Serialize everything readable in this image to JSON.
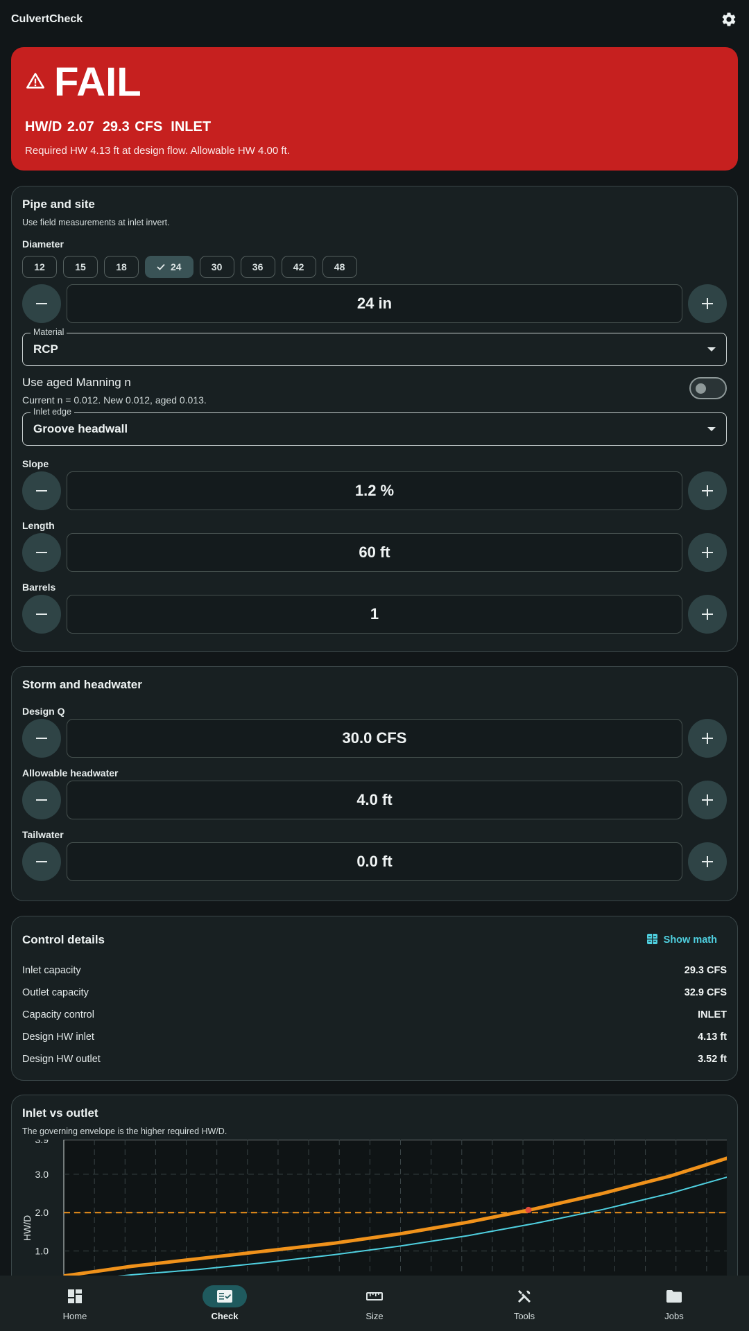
{
  "app": {
    "title": "CulvertCheck"
  },
  "result": {
    "status": "FAIL",
    "hw_d": "HW/D 2.07",
    "flow": "29.3 CFS",
    "control": "INLET",
    "note": "Required HW 4.13 ft at design flow. Allowable HW 4.00 ft.",
    "color": "#c6201f"
  },
  "pipe": {
    "title": "Pipe and site",
    "subtitle": "Use field measurements at inlet invert.",
    "diameter_label": "Diameter",
    "diameter_options": [
      "12",
      "15",
      "18",
      "24",
      "30",
      "36",
      "42",
      "48"
    ],
    "diameter_selected": "24",
    "diameter_value": "24 in",
    "material_label": "Material",
    "material_value": "RCP",
    "aged_title": "Use aged Manning n",
    "aged_sub": "Current n = 0.012. New 0.012, aged 0.013.",
    "aged_enabled": false,
    "inlet_label": "Inlet edge",
    "inlet_value": "Groove headwall",
    "slope_label": "Slope",
    "slope_value": "1.2 %",
    "length_label": "Length",
    "length_value": "60 ft",
    "barrels_label": "Barrels",
    "barrels_value": "1"
  },
  "storm": {
    "title": "Storm and headwater",
    "q_label": "Design Q",
    "q_value": "30.0 CFS",
    "hw_label": "Allowable headwater",
    "hw_value": "4.0 ft",
    "tw_label": "Tailwater",
    "tw_value": "0.0 ft"
  },
  "control": {
    "title": "Control details",
    "show_math": "Show math",
    "rows": [
      {
        "k": "Inlet capacity",
        "v": "29.3 CFS"
      },
      {
        "k": "Outlet capacity",
        "v": "32.9 CFS"
      },
      {
        "k": "Capacity control",
        "v": "INLET"
      },
      {
        "k": "Design HW inlet",
        "v": "4.13 ft"
      },
      {
        "k": "Design HW outlet",
        "v": "3.52 ft"
      }
    ]
  },
  "chart": {
    "title": "Inlet vs outlet",
    "subtitle": "The governing envelope is the higher required HW/D."
  },
  "chart_data": {
    "type": "line",
    "title": "Inlet vs outlet",
    "xlabel": "",
    "ylabel": "HW/D",
    "yticks": [
      "3.9",
      "3.0",
      "2.0",
      "1.0"
    ],
    "ylim": [
      0,
      3.9
    ],
    "xlim": [
      0,
      1
    ],
    "grid": true,
    "series": [
      {
        "x": [
          0,
          0.1,
          0.2,
          0.3,
          0.4,
          0.5,
          0.6,
          0.7,
          0.8,
          0.9,
          1.0
        ],
        "values": [
          0.35,
          0.6,
          0.8,
          1.0,
          1.2,
          1.45,
          1.75,
          2.1,
          2.5,
          2.95,
          3.5
        ],
        "color": "#f0921b"
      },
      {
        "x": [
          0,
          0.1,
          0.2,
          0.3,
          0.4,
          0.5,
          0.6,
          0.7,
          0.8,
          0.9,
          1.0
        ],
        "values": [
          0.2,
          0.38,
          0.52,
          0.7,
          0.9,
          1.13,
          1.4,
          1.72,
          2.08,
          2.5,
          3.0
        ],
        "color": "#4fd0e0"
      }
    ],
    "reference_line": {
      "y": 2.0,
      "color": "#f0921b"
    },
    "design_point": {
      "x": 0.69,
      "y": 2.07,
      "color": "#e24a3b"
    }
  },
  "nav": {
    "items": [
      {
        "label": "Home",
        "icon": "dashboard-icon"
      },
      {
        "label": "Check",
        "icon": "fact-check-icon"
      },
      {
        "label": "Size",
        "icon": "ruler-icon"
      },
      {
        "label": "Tools",
        "icon": "tools-icon"
      },
      {
        "label": "Jobs",
        "icon": "folder-icon"
      }
    ],
    "active": "Check"
  }
}
